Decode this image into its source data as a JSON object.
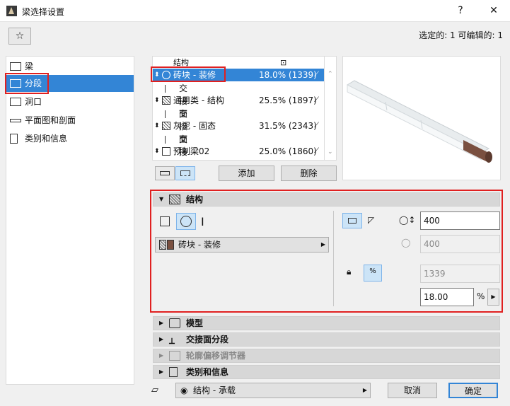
{
  "window": {
    "title": "梁选择设置",
    "help_label": "?",
    "close_label": "✕",
    "selection_info": "选定的: 1 可编辑的: 1"
  },
  "nav": {
    "items": [
      {
        "label": "梁",
        "icon": "beam-icon",
        "selected": false
      },
      {
        "label": "分段",
        "icon": "segments-icon",
        "selected": true
      },
      {
        "label": "洞口",
        "icon": "hole-icon",
        "selected": false
      },
      {
        "label": "平面图和剖面",
        "icon": "floorplan-section-icon",
        "selected": false
      },
      {
        "label": "类别和信息",
        "icon": "classification-icon",
        "selected": false
      }
    ]
  },
  "segments": {
    "header_label": "结构",
    "rows": [
      {
        "name": "砖块 - 装修",
        "percent": "18.0% (1339)",
        "sub": "交接面",
        "selected": true
      },
      {
        "name": "通用类 - 结构",
        "percent": "25.5% (1897)",
        "sub": "交接面",
        "selected": false
      },
      {
        "name": "灰泥 - 固态",
        "percent": "31.5% (2343)",
        "sub": "交接面",
        "selected": false
      },
      {
        "name": "预制梁02",
        "percent": "25.0% (1860)",
        "sub": "",
        "selected": false
      }
    ],
    "add_label": "添加",
    "delete_label": "删除"
  },
  "structure_panel": {
    "title": "结构",
    "material": "砖块 - 装修",
    "width_value": "400",
    "height_value": "400",
    "length_value": "1339",
    "percent_value": "18.00",
    "percent_unit": "%",
    "percent_button": "%"
  },
  "collapsed_panels": [
    {
      "title": "模型",
      "disabled": false
    },
    {
      "title": "交接面分段",
      "disabled": false
    },
    {
      "title": "轮廓偏移调节器",
      "disabled": true
    },
    {
      "title": "类别和信息",
      "disabled": false
    }
  ],
  "footer": {
    "layer": "结构 - 承载",
    "cancel_label": "取消",
    "ok_label": "确定"
  },
  "colors": {
    "accent": "#3385d6",
    "highlight_border": "#e02020",
    "beam_end": "#7a5040"
  }
}
